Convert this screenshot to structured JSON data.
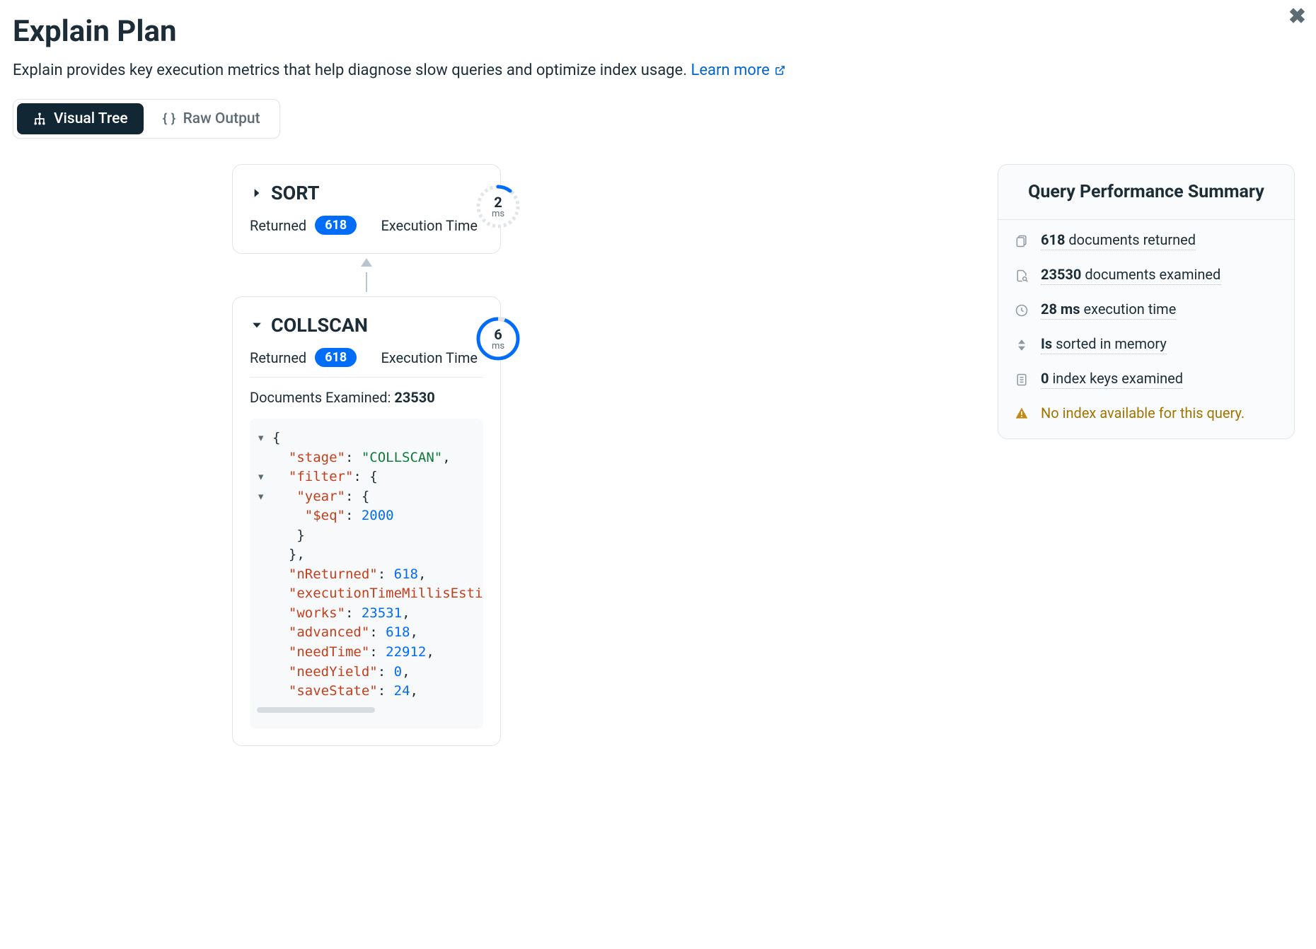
{
  "title": "Explain Plan",
  "description": "Explain provides key execution metrics that help diagnose slow queries and optimize index usage. ",
  "learn_more": "Learn more",
  "tabs": {
    "visual_tree": "Visual Tree",
    "raw_output": "Raw Output"
  },
  "stages": {
    "sort": {
      "name": "SORT",
      "returned_label": "Returned",
      "returned_count": "618",
      "exec_label": "Execution Time",
      "time_value": "2",
      "time_unit": "ms"
    },
    "collscan": {
      "name": "COLLSCAN",
      "returned_label": "Returned",
      "returned_count": "618",
      "exec_label": "Execution Time",
      "time_value": "6",
      "time_unit": "ms",
      "docs_examined_label": "Documents Examined: ",
      "docs_examined_value": "23530"
    }
  },
  "json_detail": {
    "stage_key": "\"stage\"",
    "stage_val": "\"COLLSCAN\"",
    "filter_key": "\"filter\"",
    "year_key": "\"year\"",
    "eq_key": "\"$eq\"",
    "eq_val": "2000",
    "nReturned_key": "\"nReturned\"",
    "nReturned_val": "618",
    "etme_key": "\"executionTimeMillisEstimat",
    "works_key": "\"works\"",
    "works_val": "23531",
    "advanced_key": "\"advanced\"",
    "advanced_val": "618",
    "needTime_key": "\"needTime\"",
    "needTime_val": "22912",
    "needYield_key": "\"needYield\"",
    "needYield_val": "0",
    "saveState_key": "\"saveState\"",
    "saveState_val": "24"
  },
  "summary": {
    "title": "Query Performance Summary",
    "docs_returned_bold": "618",
    "docs_returned_rest": " documents returned",
    "docs_examined_bold": "23530",
    "docs_examined_rest": " documents examined",
    "exec_time_bold": "28 ms",
    "exec_time_rest": " execution time",
    "sorted_bold": "Is",
    "sorted_rest": " sorted in memory",
    "index_keys_bold": "0",
    "index_keys_rest": " index keys examined",
    "warning": "No index available for this query."
  }
}
